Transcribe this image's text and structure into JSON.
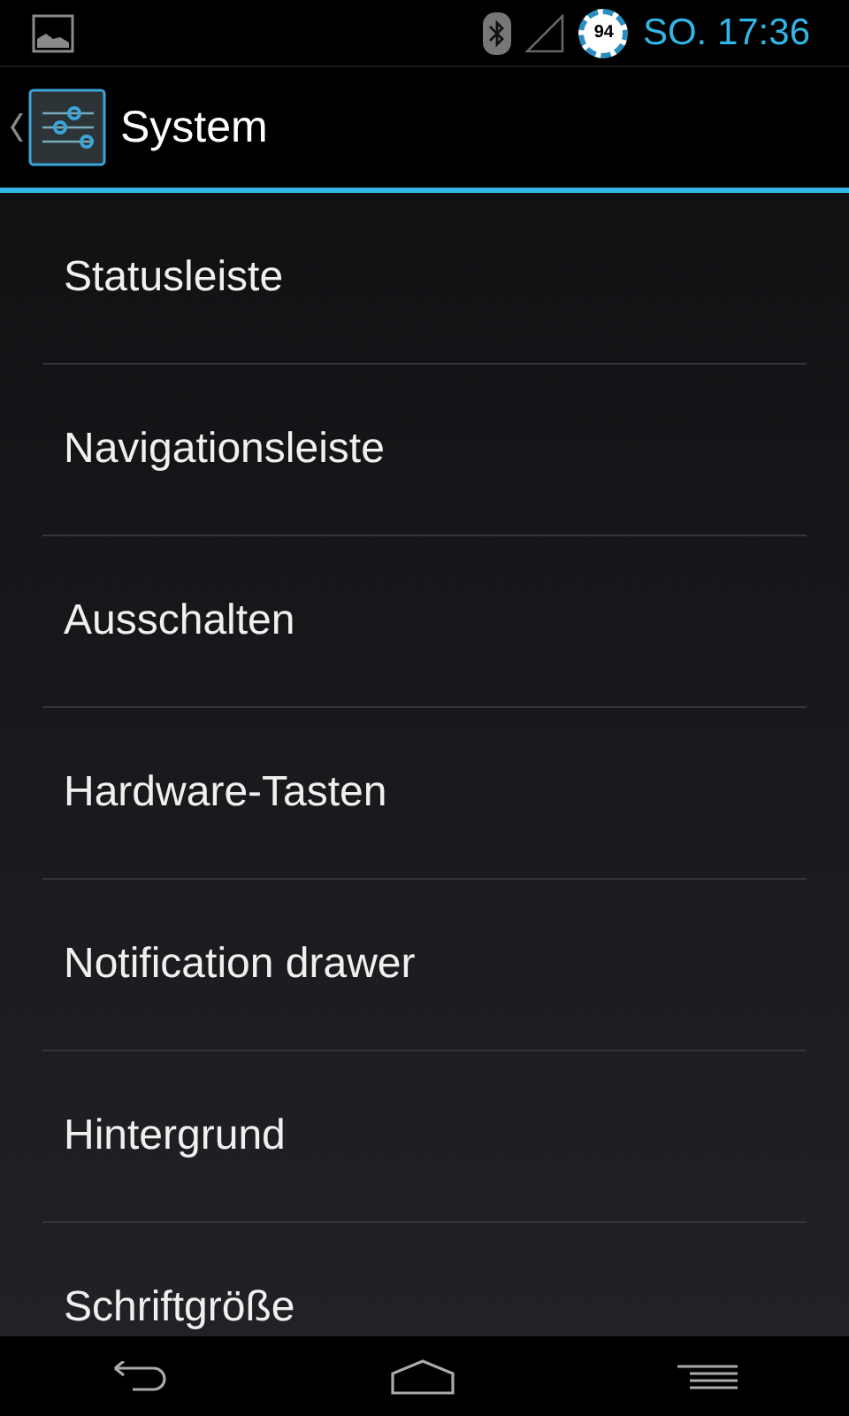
{
  "status_bar": {
    "battery": "94",
    "time": "SO. 17:36"
  },
  "action_bar": {
    "title": "System"
  },
  "items": [
    {
      "label": "Statusleiste"
    },
    {
      "label": "Navigationsleiste"
    },
    {
      "label": "Ausschalten"
    },
    {
      "label": "Hardware-Tasten"
    },
    {
      "label": "Notification drawer"
    },
    {
      "label": "Hintergrund"
    },
    {
      "label": "Schriftgröße"
    }
  ]
}
